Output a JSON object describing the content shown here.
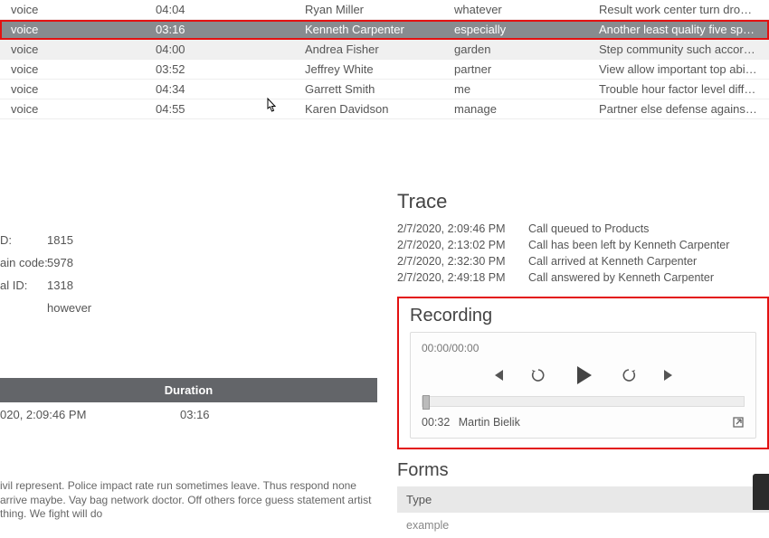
{
  "table": {
    "rows": [
      {
        "type": "voice",
        "duration": "04:04",
        "agent": "Ryan Miller",
        "wrapup": "whatever",
        "message": "Result work center turn drop si…"
      },
      {
        "type": "voice",
        "duration": "03:16",
        "agent": "Kenneth Carpenter",
        "wrapup": "especially",
        "message": "Another least quality five spen…",
        "selected": true
      },
      {
        "type": "voice",
        "duration": "04:00",
        "agent": "Andrea Fisher",
        "wrapup": "garden",
        "message": "Step community such accordin…",
        "hover": true
      },
      {
        "type": "voice",
        "duration": "03:52",
        "agent": "Jeffrey White",
        "wrapup": "partner",
        "message": "View allow important top abilit…"
      },
      {
        "type": "voice",
        "duration": "04:34",
        "agent": "Garrett Smith",
        "wrapup": "me",
        "message": "Trouble hour factor level differe…"
      },
      {
        "type": "voice",
        "duration": "04:55",
        "agent": "Karen Davidson",
        "wrapup": "manage",
        "message": "Partner else defense against m…"
      }
    ]
  },
  "details": {
    "id_label": "D:",
    "id_value": "1815",
    "chain_label": "ain code:",
    "chain_value": "5978",
    "alid_label": "al ID:",
    "alid_value": "1318",
    "extra_label": "",
    "extra_value": "however"
  },
  "duration_header": "Duration",
  "duration_row": {
    "time": "020, 2:09:46 PM",
    "dur": "03:16"
  },
  "notes_text": "ivil represent. Police impact rate run sometimes leave. Thus respond none arrive maybe. Vay bag network doctor. Off others force guess statement artist thing. We fight will do",
  "trace": {
    "title": "Trace",
    "rows": [
      {
        "time": "2/7/2020, 2:09:46 PM",
        "msg": "Call queued to Products"
      },
      {
        "time": "2/7/2020, 2:13:02 PM",
        "msg": "Call has been left by Kenneth Carpenter"
      },
      {
        "time": "2/7/2020, 2:32:30 PM",
        "msg": "Call arrived at Kenneth Carpenter"
      },
      {
        "time": "2/7/2020, 2:49:18 PM",
        "msg": "Call answered by Kenneth Carpenter"
      }
    ]
  },
  "recording": {
    "title": "Recording",
    "time_readout": "00:00/00:00",
    "meta_time": "00:32",
    "meta_name": "Martin Bielik"
  },
  "forms": {
    "title": "Forms",
    "type_label": "Type",
    "row_value": "example"
  }
}
